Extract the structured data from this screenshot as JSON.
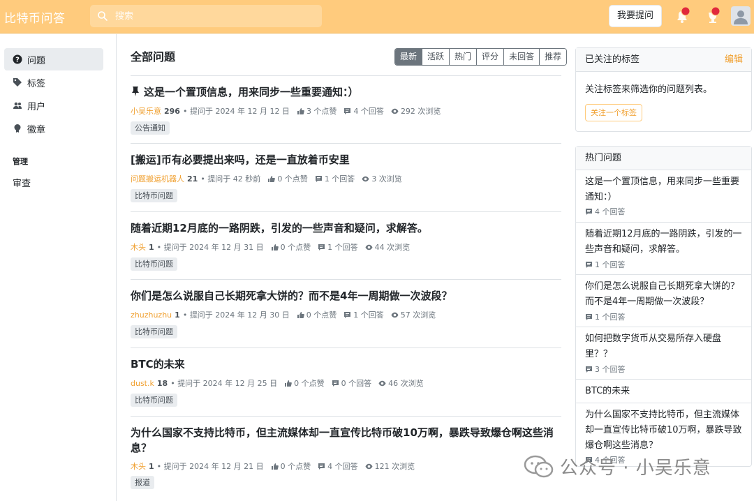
{
  "header": {
    "brand": "比特币问答",
    "search_placeholder": "搜索",
    "ask_button": "我要提问",
    "accent": "#ffcb7d",
    "notification_dot": "#e0283c"
  },
  "sidebar": {
    "items": [
      {
        "label": "问题",
        "icon": "question-circle-icon",
        "active": true
      },
      {
        "label": "标签",
        "icon": "tag-icon",
        "active": false
      },
      {
        "label": "用户",
        "icon": "users-icon",
        "active": false
      },
      {
        "label": "徽章",
        "icon": "badge-icon",
        "active": false
      }
    ],
    "group_title": "管理",
    "group_items": [
      {
        "label": "审查"
      }
    ]
  },
  "main": {
    "title": "全部问题",
    "tabs": [
      "最新",
      "活跃",
      "热门",
      "评分",
      "未回答",
      "推荐"
    ],
    "active_tab": "最新",
    "questions": [
      {
        "title": "这是一个置顶信息，用来同步一些重要通知：）",
        "pinned": true,
        "author": "小吴乐意",
        "rep": "296",
        "asked": "提问于 2024 年 12 月 12 日",
        "votes": "3 个点赞",
        "answers": "4 个回答",
        "views": "292 次浏览",
        "tag": "公告通知"
      },
      {
        "title": "[搬运]币有必要提出来吗，还是一直放着币安里",
        "pinned": false,
        "author": "问题搬运机器人",
        "rep": "21",
        "asked": "提问于 42 秒前",
        "votes": "0 个点赞",
        "answers": "1 个回答",
        "views": "3 次浏览",
        "tag": "比特币问题"
      },
      {
        "title": "随着近期12月底的一路阴跌，引发的一些声音和疑问，求解答。",
        "pinned": false,
        "author": "木头",
        "rep": "1",
        "asked": "提问于 2024 年 12 月 31 日",
        "votes": "0 个点赞",
        "answers": "1 个回答",
        "views": "44 次浏览",
        "tag": "比特币问题"
      },
      {
        "title": "你们是怎么说服自己长期死拿大饼的？而不是4年一周期做一次波段？",
        "pinned": false,
        "author": "zhuzhuzhu",
        "rep": "1",
        "asked": "提问于 2024 年 12 月 30 日",
        "votes": "0 个点赞",
        "answers": "1 个回答",
        "views": "57 次浏览",
        "tag": "比特币问题"
      },
      {
        "title": "BTC的未来",
        "pinned": false,
        "author": "dust.k",
        "rep": "18",
        "asked": "提问于 2024 年 12 月 25 日",
        "votes": "0 个点赞",
        "answers": "0 个回答",
        "views": "46 次浏览",
        "tag": "比特币问题"
      },
      {
        "title": "为什么国家不支持比特币，但主流媒体却一直宣传比特币破10万啊，暴跌导致爆仓啊这些消息？",
        "pinned": false,
        "author": "木头",
        "rep": "1",
        "asked": "提问于 2024 年 12 月 21 日",
        "votes": "0 个点赞",
        "answers": "4 个回答",
        "views": "121 次浏览",
        "tag": "报道"
      }
    ]
  },
  "followed_tags": {
    "title": "已关注的标签",
    "edit": "编辑",
    "text": "关注标签来筛选你的问题列表。",
    "button": "关注一个标签"
  },
  "hot_questions": {
    "title": "热门问题",
    "items": [
      {
        "title": "这是一个置顶信息，用来同步一些重要通知：）",
        "answers": "4 个回答"
      },
      {
        "title": "随着近期12月底的一路阴跌，引发的一些声音和疑问，求解答。",
        "answers": "1 个回答"
      },
      {
        "title": "你们是怎么说服自己长期死拿大饼的？而不是4年一周期做一次波段？",
        "answers": "1 个回答"
      },
      {
        "title": "如何把数字货币从交易所存入硬盘里？？",
        "answers": "3 个回答"
      },
      {
        "title": "BTC的未来",
        "answers": ""
      },
      {
        "title": "为什么国家不支持比特币，但主流媒体却一直宣传比特币破10万啊，暴跌导致爆仓啊这些消息？",
        "answers": "4 个回答"
      }
    ]
  },
  "watermark": {
    "text": "公众号 · 小吴乐意"
  }
}
